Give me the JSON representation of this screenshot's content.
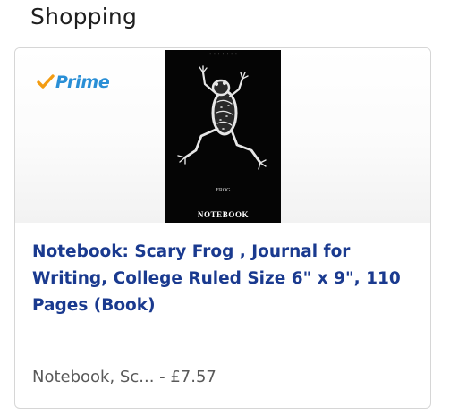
{
  "section": {
    "title": "Shopping"
  },
  "card": {
    "badge": {
      "text": "Prime",
      "icon": "check-icon",
      "color": "#2a8fd6",
      "check_color": "#f39c12"
    },
    "book_cover": {
      "footer_text": "NOTEBOOK",
      "frog_label": "FROG",
      "background": "#050505"
    },
    "title": "Notebook: Scary Frog , Journal for Writing, College Ruled Size 6\" x 9\", 110 Pages (Book)",
    "meta": "Notebook, Sc... - £7.57",
    "title_color": "#1a3a8f"
  }
}
